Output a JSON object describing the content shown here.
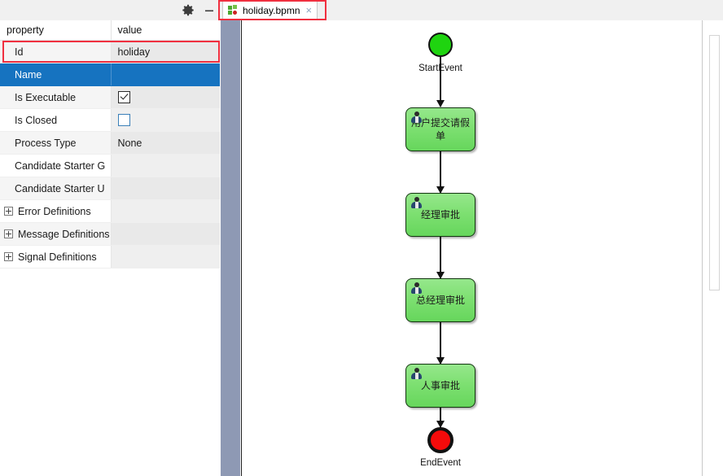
{
  "window": {
    "title": "holiday.bpmn"
  },
  "properties_panel": {
    "toolbar": {
      "settings_icon": "gear-icon",
      "minimize_icon": "minimize-icon"
    },
    "columns": [
      "property",
      "value"
    ],
    "rows": [
      {
        "name": "Id",
        "value": "holiday",
        "type": "text",
        "selected": false,
        "expandable": false
      },
      {
        "name": "Name",
        "value": "",
        "type": "text",
        "selected": true,
        "expandable": false
      },
      {
        "name": "Is Executable",
        "value": "checked",
        "type": "checkbox",
        "selected": false,
        "expandable": false
      },
      {
        "name": "Is Closed",
        "value": "unchecked",
        "type": "checkbox",
        "selected": false,
        "expandable": false
      },
      {
        "name": "Process Type",
        "value": "None",
        "type": "text",
        "selected": false,
        "expandable": false
      },
      {
        "name": "Candidate Starter G",
        "value": "",
        "type": "text",
        "selected": false,
        "expandable": false
      },
      {
        "name": "Candidate Starter U",
        "value": "",
        "type": "text",
        "selected": false,
        "expandable": false
      },
      {
        "name": "Error Definitions",
        "value": "",
        "type": "text",
        "selected": false,
        "expandable": true
      },
      {
        "name": "Message Definitions",
        "value": "",
        "type": "text",
        "selected": false,
        "expandable": true
      },
      {
        "name": "Signal Definitions",
        "value": "",
        "type": "text",
        "selected": false,
        "expandable": true
      }
    ]
  },
  "editor": {
    "tab": {
      "label": "holiday.bpmn",
      "close_glyph": "×",
      "icon": "bpmn-file-icon",
      "active": true
    }
  },
  "diagram": {
    "type": "bpmn-process",
    "nodes": [
      {
        "id": "start",
        "kind": "start-event",
        "label": "StartEvent",
        "text": ""
      },
      {
        "id": "task1",
        "kind": "user-task",
        "label": "",
        "text": "用户提交请假单"
      },
      {
        "id": "task2",
        "kind": "user-task",
        "label": "",
        "text": "经理审批"
      },
      {
        "id": "task3",
        "kind": "user-task",
        "label": "",
        "text": "总经理审批"
      },
      {
        "id": "task4",
        "kind": "user-task",
        "label": "",
        "text": "人事审批"
      },
      {
        "id": "end",
        "kind": "end-event",
        "label": "EndEvent",
        "text": ""
      }
    ],
    "flows": [
      {
        "from": "start",
        "to": "task1"
      },
      {
        "from": "task1",
        "to": "task2"
      },
      {
        "from": "task2",
        "to": "task3"
      },
      {
        "from": "task3",
        "to": "task4"
      },
      {
        "from": "task4",
        "to": "end"
      }
    ]
  },
  "annotations": {
    "highlight_color": "#f03040",
    "boxes": [
      "id-row",
      "editor-tab"
    ]
  },
  "colors": {
    "selection_blue": "#1673c0",
    "start_event_green": "#1fd410",
    "end_event_red": "#f50b0b",
    "task_green": "#7ee072",
    "splitter": "#8e99b4"
  }
}
